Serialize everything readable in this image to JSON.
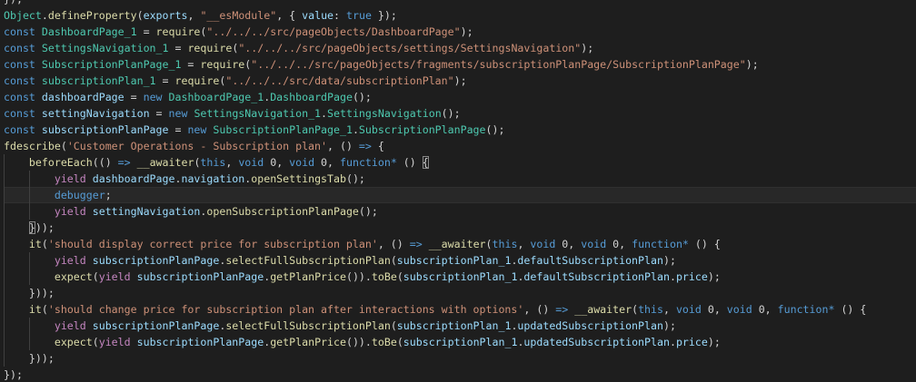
{
  "editor": {
    "colors": {
      "background": "#1e1e1e",
      "keyword": "#569cd6",
      "control": "#c586c0",
      "variable": "#9cdcfe",
      "type": "#4ec9b0",
      "function": "#dcdcaa",
      "string": "#ce9178",
      "plain": "#d4d4d4"
    },
    "lines": [
      {
        "indent": 0,
        "tokens": [
          [
            "plain",
            "});"
          ]
        ]
      },
      {
        "indent": 0,
        "tokens": [
          [
            "type",
            "Object"
          ],
          [
            "plain",
            "."
          ],
          [
            "function",
            "defineProperty"
          ],
          [
            "plain",
            "("
          ],
          [
            "variable",
            "exports"
          ],
          [
            "plain",
            ", "
          ],
          [
            "string",
            "\"__esModule\""
          ],
          [
            "plain",
            ", { "
          ],
          [
            "variable",
            "value"
          ],
          [
            "plain",
            ": "
          ],
          [
            "keyword",
            "true"
          ],
          [
            "plain",
            " });"
          ]
        ]
      },
      {
        "indent": 0,
        "tokens": [
          [
            "keyword",
            "const "
          ],
          [
            "type",
            "DashboardPage_1"
          ],
          [
            "plain",
            " = "
          ],
          [
            "function",
            "require"
          ],
          [
            "plain",
            "("
          ],
          [
            "string",
            "\"../../../src/pageObjects/DashboardPage\""
          ],
          [
            "plain",
            ");"
          ]
        ]
      },
      {
        "indent": 0,
        "tokens": [
          [
            "keyword",
            "const "
          ],
          [
            "type",
            "SettingsNavigation_1"
          ],
          [
            "plain",
            " = "
          ],
          [
            "function",
            "require"
          ],
          [
            "plain",
            "("
          ],
          [
            "string",
            "\"../../../src/pageObjects/settings/SettingsNavigation\""
          ],
          [
            "plain",
            ");"
          ]
        ]
      },
      {
        "indent": 0,
        "tokens": [
          [
            "keyword",
            "const "
          ],
          [
            "type",
            "SubscriptionPlanPage_1"
          ],
          [
            "plain",
            " = "
          ],
          [
            "function",
            "require"
          ],
          [
            "plain",
            "("
          ],
          [
            "string",
            "\"../../../src/pageObjects/fragments/subscriptionPlanPage/SubscriptionPlanPage\""
          ],
          [
            "plain",
            ");"
          ]
        ]
      },
      {
        "indent": 0,
        "tokens": [
          [
            "keyword",
            "const "
          ],
          [
            "type",
            "subscriptionPlan_1"
          ],
          [
            "plain",
            " = "
          ],
          [
            "function",
            "require"
          ],
          [
            "plain",
            "("
          ],
          [
            "string",
            "\"../../../src/data/subscriptionPlan\""
          ],
          [
            "plain",
            ");"
          ]
        ]
      },
      {
        "indent": 0,
        "tokens": [
          [
            "keyword",
            "const "
          ],
          [
            "variable",
            "dashboardPage"
          ],
          [
            "plain",
            " = "
          ],
          [
            "keyword",
            "new "
          ],
          [
            "type",
            "DashboardPage_1"
          ],
          [
            "plain",
            "."
          ],
          [
            "type",
            "DashboardPage"
          ],
          [
            "plain",
            "();"
          ]
        ]
      },
      {
        "indent": 0,
        "tokens": [
          [
            "keyword",
            "const "
          ],
          [
            "variable",
            "settingNavigation"
          ],
          [
            "plain",
            " = "
          ],
          [
            "keyword",
            "new "
          ],
          [
            "type",
            "SettingsNavigation_1"
          ],
          [
            "plain",
            "."
          ],
          [
            "type",
            "SettingsNavigation"
          ],
          [
            "plain",
            "();"
          ]
        ]
      },
      {
        "indent": 0,
        "tokens": [
          [
            "keyword",
            "const "
          ],
          [
            "variable",
            "subscriptionPlanPage"
          ],
          [
            "plain",
            " = "
          ],
          [
            "keyword",
            "new "
          ],
          [
            "type",
            "SubscriptionPlanPage_1"
          ],
          [
            "plain",
            "."
          ],
          [
            "type",
            "SubscriptionPlanPage"
          ],
          [
            "plain",
            "();"
          ]
        ]
      },
      {
        "indent": 0,
        "tokens": [
          [
            "function",
            "fdescribe"
          ],
          [
            "plain",
            "("
          ],
          [
            "string",
            "'Customer Operations - Subscription plan'"
          ],
          [
            "plain",
            ", () "
          ],
          [
            "keyword",
            "=>"
          ],
          [
            "plain",
            " {"
          ]
        ]
      },
      {
        "indent": 1,
        "tokens": [
          [
            "function",
            "beforeEach"
          ],
          [
            "plain",
            "(() "
          ],
          [
            "keyword",
            "=>"
          ],
          [
            "plain",
            " "
          ],
          [
            "function",
            "__awaiter"
          ],
          [
            "plain",
            "("
          ],
          [
            "keyword",
            "this"
          ],
          [
            "plain",
            ", "
          ],
          [
            "keyword",
            "void"
          ],
          [
            "plain",
            " 0, "
          ],
          [
            "keyword",
            "void"
          ],
          [
            "plain",
            " 0, "
          ],
          [
            "keyword",
            "function*"
          ],
          [
            "plain",
            " () "
          ],
          [
            "bracket",
            "{"
          ]
        ]
      },
      {
        "indent": 2,
        "tokens": [
          [
            "control",
            "yield "
          ],
          [
            "variable",
            "dashboardPage"
          ],
          [
            "plain",
            "."
          ],
          [
            "variable",
            "navigation"
          ],
          [
            "plain",
            "."
          ],
          [
            "function",
            "openSettingsTab"
          ],
          [
            "plain",
            "();"
          ]
        ]
      },
      {
        "indent": 2,
        "active": true,
        "tokens": [
          [
            "keyword",
            "debugger"
          ],
          [
            "plain",
            ";"
          ]
        ]
      },
      {
        "indent": 2,
        "tokens": [
          [
            "control",
            "yield "
          ],
          [
            "variable",
            "settingNavigation"
          ],
          [
            "plain",
            "."
          ],
          [
            "function",
            "openSubscriptionPlanPage"
          ],
          [
            "plain",
            "();"
          ]
        ]
      },
      {
        "indent": 1,
        "tokens": [
          [
            "bracket",
            "}"
          ],
          [
            "plain",
            "));"
          ]
        ]
      },
      {
        "indent": 1,
        "tokens": [
          [
            "function",
            "it"
          ],
          [
            "plain",
            "("
          ],
          [
            "string",
            "'should display correct price for subscription plan'"
          ],
          [
            "plain",
            ", () "
          ],
          [
            "keyword",
            "=>"
          ],
          [
            "plain",
            " "
          ],
          [
            "function",
            "__awaiter"
          ],
          [
            "plain",
            "("
          ],
          [
            "keyword",
            "this"
          ],
          [
            "plain",
            ", "
          ],
          [
            "keyword",
            "void"
          ],
          [
            "plain",
            " 0, "
          ],
          [
            "keyword",
            "void"
          ],
          [
            "plain",
            " 0, "
          ],
          [
            "keyword",
            "function*"
          ],
          [
            "plain",
            " () {"
          ]
        ]
      },
      {
        "indent": 2,
        "tokens": [
          [
            "control",
            "yield "
          ],
          [
            "variable",
            "subscriptionPlanPage"
          ],
          [
            "plain",
            "."
          ],
          [
            "function",
            "selectFullSubscriptionPlan"
          ],
          [
            "plain",
            "("
          ],
          [
            "variable",
            "subscriptionPlan_1"
          ],
          [
            "plain",
            "."
          ],
          [
            "variable",
            "defaultSubscriptionPlan"
          ],
          [
            "plain",
            ");"
          ]
        ]
      },
      {
        "indent": 2,
        "tokens": [
          [
            "function",
            "expect"
          ],
          [
            "plain",
            "("
          ],
          [
            "control",
            "yield "
          ],
          [
            "variable",
            "subscriptionPlanPage"
          ],
          [
            "plain",
            "."
          ],
          [
            "function",
            "getPlanPrice"
          ],
          [
            "plain",
            "())."
          ],
          [
            "function",
            "toBe"
          ],
          [
            "plain",
            "("
          ],
          [
            "variable",
            "subscriptionPlan_1"
          ],
          [
            "plain",
            "."
          ],
          [
            "variable",
            "defaultSubscriptionPlan"
          ],
          [
            "plain",
            "."
          ],
          [
            "variable",
            "price"
          ],
          [
            "plain",
            ");"
          ]
        ]
      },
      {
        "indent": 1,
        "tokens": [
          [
            "plain",
            "}));"
          ]
        ]
      },
      {
        "indent": 1,
        "tokens": [
          [
            "function",
            "it"
          ],
          [
            "plain",
            "("
          ],
          [
            "string",
            "'should change price for subscription plan after interactions with options'"
          ],
          [
            "plain",
            ", () "
          ],
          [
            "keyword",
            "=>"
          ],
          [
            "plain",
            " "
          ],
          [
            "function",
            "__awaiter"
          ],
          [
            "plain",
            "("
          ],
          [
            "keyword",
            "this"
          ],
          [
            "plain",
            ", "
          ],
          [
            "keyword",
            "void"
          ],
          [
            "plain",
            " 0, "
          ],
          [
            "keyword",
            "void"
          ],
          [
            "plain",
            " 0, "
          ],
          [
            "keyword",
            "function*"
          ],
          [
            "plain",
            " () {"
          ]
        ]
      },
      {
        "indent": 2,
        "tokens": [
          [
            "control",
            "yield "
          ],
          [
            "variable",
            "subscriptionPlanPage"
          ],
          [
            "plain",
            "."
          ],
          [
            "function",
            "selectFullSubscriptionPlan"
          ],
          [
            "plain",
            "("
          ],
          [
            "variable",
            "subscriptionPlan_1"
          ],
          [
            "plain",
            "."
          ],
          [
            "variable",
            "updatedSubscriptionPlan"
          ],
          [
            "plain",
            ");"
          ]
        ]
      },
      {
        "indent": 2,
        "tokens": [
          [
            "function",
            "expect"
          ],
          [
            "plain",
            "("
          ],
          [
            "control",
            "yield "
          ],
          [
            "variable",
            "subscriptionPlanPage"
          ],
          [
            "plain",
            "."
          ],
          [
            "function",
            "getPlanPrice"
          ],
          [
            "plain",
            "())."
          ],
          [
            "function",
            "toBe"
          ],
          [
            "plain",
            "("
          ],
          [
            "variable",
            "subscriptionPlan_1"
          ],
          [
            "plain",
            "."
          ],
          [
            "variable",
            "updatedSubscriptionPlan"
          ],
          [
            "plain",
            "."
          ],
          [
            "variable",
            "price"
          ],
          [
            "plain",
            ");"
          ]
        ]
      },
      {
        "indent": 1,
        "tokens": [
          [
            "plain",
            "}));"
          ]
        ]
      },
      {
        "indent": 0,
        "tokens": [
          [
            "plain",
            "});"
          ]
        ]
      }
    ]
  }
}
